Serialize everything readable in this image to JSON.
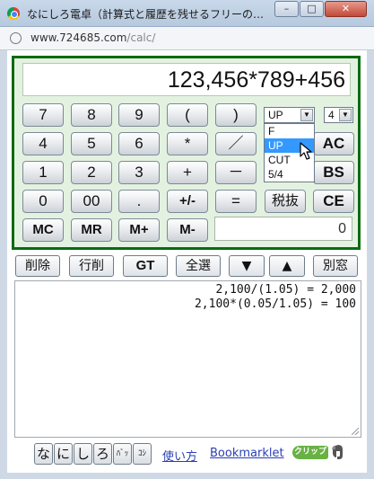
{
  "window": {
    "title": "なにしろ電卓（計算式と履歴を残せるフリーの…",
    "min_label": "–",
    "max_label": "□",
    "close_label": "✕"
  },
  "address": {
    "domain": "www.724685.com",
    "path": "/calc/"
  },
  "calculator": {
    "display": "123,456*789+456",
    "memory_display": "0",
    "rows": [
      [
        "7",
        "8",
        "9",
        "(",
        ")"
      ],
      [
        "4",
        "5",
        "6",
        "*",
        "／"
      ],
      [
        "1",
        "2",
        "3",
        "+",
        "－"
      ],
      [
        "0",
        "00",
        ".",
        "+/-",
        "="
      ],
      [
        "MC",
        "MR",
        "M+",
        "M-"
      ]
    ],
    "right_keys": {
      "ac": "AC",
      "bs": "BS",
      "tax": "税抜",
      "ce": "CE"
    },
    "rounding_select": {
      "selected": "UP",
      "options": [
        "F",
        "UP",
        "CUT",
        "5/4"
      ],
      "highlighted": "UP"
    },
    "digits_select": {
      "selected": "4"
    }
  },
  "toolbar": {
    "delete": "削除",
    "delete_row": "行削",
    "gt": "GT",
    "select_all": "全選",
    "down": "▼",
    "up": "▲",
    "new_window": "別窓"
  },
  "history": {
    "lines": [
      "2,100/(1.05) = 2,000",
      "2,100*(0.05/1.05) = 100"
    ]
  },
  "footer": {
    "themes": [
      "な",
      "に",
      "し",
      "ろ",
      "ﾊﾞｯ",
      "ｺｼ"
    ],
    "usage_link": "使い方",
    "bookmarklet_link": "Bookmarklet",
    "clip_label": "クリップ"
  }
}
